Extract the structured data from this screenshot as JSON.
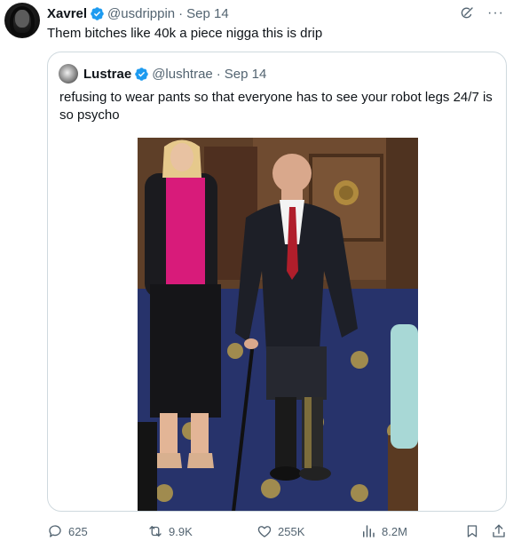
{
  "tweet": {
    "author": {
      "name": "Xavrel",
      "handle": "@usdrippin",
      "date": "Sep 14"
    },
    "separator": "·",
    "text": "Them bitches like 40k a piece nigga this is drip",
    "more_glyph": "···"
  },
  "quoted": {
    "author": {
      "name": "Lustrae",
      "handle": "@lushtrae",
      "date": "Sep 14"
    },
    "separator": "·",
    "text": "refusing to wear pants so that everyone has to see your robot legs 24/7 is so psycho"
  },
  "metrics": {
    "replies": "625",
    "reposts": "9.9K",
    "likes": "255K",
    "views": "8.2M"
  },
  "colors": {
    "verified": "#1d9bf0",
    "text_primary": "#0f1419",
    "text_secondary": "#536471",
    "border": "#cfd9de"
  },
  "icons": {
    "verified": "verified-badge-icon",
    "grok": "grok-icon",
    "more": "more-icon",
    "reply": "reply-icon",
    "repost": "repost-icon",
    "like": "heart-icon",
    "views": "views-icon",
    "bookmark": "bookmark-icon",
    "share": "share-icon"
  }
}
